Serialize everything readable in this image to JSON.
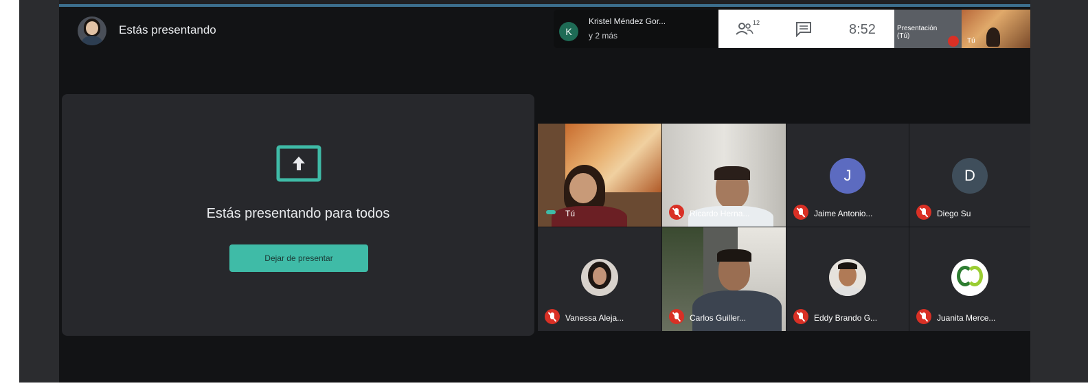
{
  "header": {
    "presenting_label": "Estás presentando"
  },
  "info": {
    "avatar_letter": "K",
    "name": "Kristel Méndez Gor...",
    "more": "y 2 más",
    "people_count": "12",
    "time": "8:52"
  },
  "self_thumb": {
    "presentation_label_line1": "Presentación",
    "presentation_label_line2": "(Tú)",
    "you_label": "Tú"
  },
  "present": {
    "message": "Estás presentando para todos",
    "stop_button": "Dejar de presentar"
  },
  "participants": [
    {
      "name": "Tú",
      "kind": "video"
    },
    {
      "name": "Ricardo Herna...",
      "kind": "video"
    },
    {
      "name": "Jaime Antonio...",
      "kind": "letter",
      "letter": "J",
      "color": "#5c6bc0"
    },
    {
      "name": "Diego Su",
      "kind": "letter",
      "letter": "D",
      "color": "#3f4e5b"
    },
    {
      "name": "Vanessa Aleja...",
      "kind": "photo"
    },
    {
      "name": "Carlos Guiller...",
      "kind": "video"
    },
    {
      "name": "Eddy Brando G...",
      "kind": "photo"
    },
    {
      "name": "Juanita Merce...",
      "kind": "logo"
    }
  ],
  "colors": {
    "accent": "#3fbba7",
    "mic_off": "#d93025",
    "panel": "#27282c",
    "background": "#121315"
  }
}
